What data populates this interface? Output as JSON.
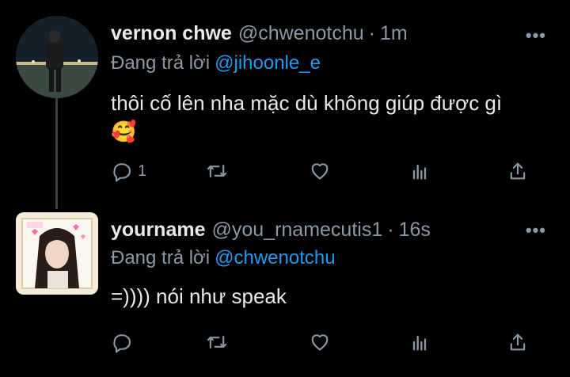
{
  "tweets": [
    {
      "name": "vernon chwe",
      "handle": "@chwenotchu",
      "time": "1m",
      "more": "•••",
      "reply_prefix": "Đang trả lời",
      "reply_to": "@jihoonle_e",
      "text": "thôi cố lên nha mặc dù không giúp được gì",
      "emoji": "🥰",
      "reply_count": "1",
      "avatar_icon": "profile-photo-person-night"
    },
    {
      "name": "yourname",
      "handle": "@you_rnamecutis1",
      "time": "16s",
      "more": "•••",
      "reply_prefix": "Đang trả lời",
      "reply_to": "@chwenotchu",
      "text": "=)))) nói như speak",
      "reply_count": "",
      "avatar_icon": "profile-photo-girl-stickers"
    }
  ],
  "colors": {
    "background": "#000000",
    "text": "#e7e9ea",
    "muted": "#8b98a5",
    "link": "#1d9bf0"
  },
  "icons": [
    "reply-icon",
    "retweet-icon",
    "like-icon",
    "analytics-icon",
    "share-icon"
  ]
}
